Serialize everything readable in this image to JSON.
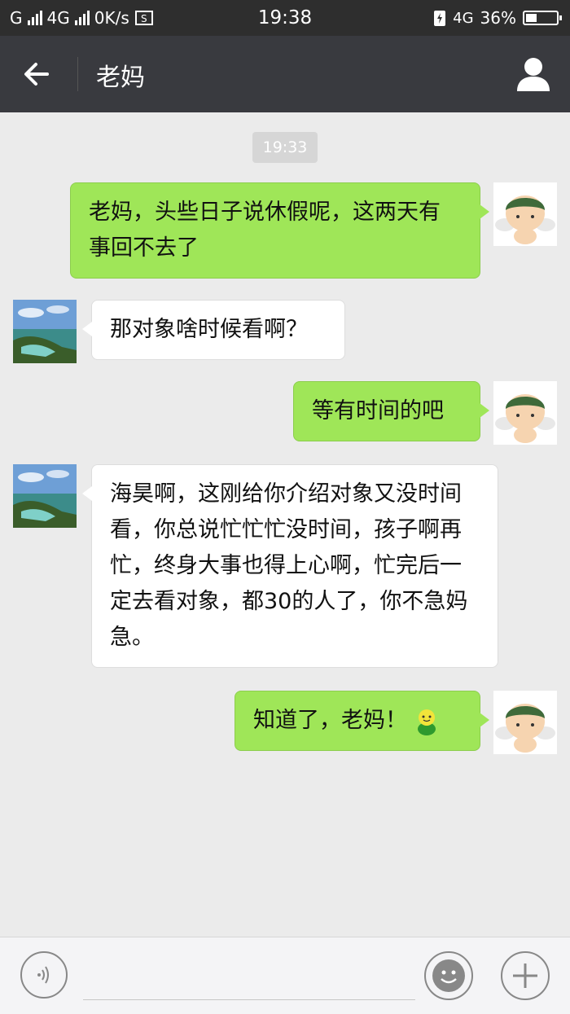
{
  "status_bar": {
    "carrier1": "G",
    "carrier2": "4G",
    "speed": "0K/s",
    "time": "19:38",
    "network": "4G",
    "battery": "36%",
    "battery_level": 0.36
  },
  "header": {
    "title": "老妈",
    "back_icon": "back-arrow-icon",
    "profile_icon": "person-icon"
  },
  "chat": {
    "timestamp": "19:33",
    "messages": [
      {
        "sender": "me",
        "text": "老妈，头些日子说休假呢，这两天有事回不去了"
      },
      {
        "sender": "mom",
        "text": "那对象啥时候看啊？"
      },
      {
        "sender": "me",
        "text": "等有时间的吧"
      },
      {
        "sender": "mom",
        "text": "海昊啊，这刚给你介绍对象又没时间看，你总说忙忙忙没时间，孩子啊再忙，终身大事也得上心啊，忙完后一定去看对象，都30的人了，你不急妈急。"
      },
      {
        "sender": "me",
        "text": "知道了，老妈！",
        "emoji": "smiley-emoji"
      }
    ]
  },
  "input_bar": {
    "voice_icon": "voice-icon",
    "emoji_icon": "emoji-icon",
    "plus_icon": "plus-icon",
    "input_value": ""
  },
  "colors": {
    "my_bubble": "#9fe658",
    "their_bubble": "#ffffff",
    "header_bg": "#393a3f",
    "chat_bg": "#ebebeb"
  }
}
